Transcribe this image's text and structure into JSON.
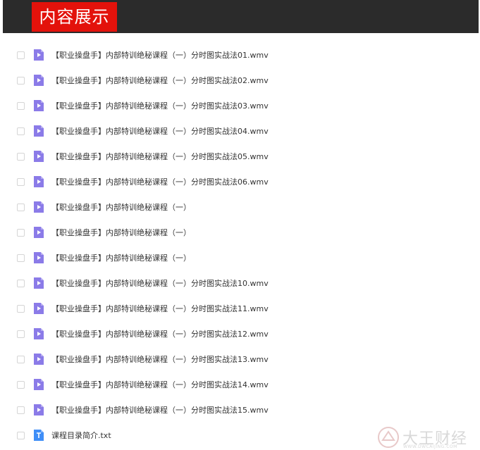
{
  "header": {
    "title": "内容展示"
  },
  "files": [
    {
      "name": "【职业操盘手】内部特训绝秘课程（一）分时图实战法01.wmv",
      "type": "video"
    },
    {
      "name": "【职业操盘手】内部特训绝秘课程（一）分时图实战法02.wmv",
      "type": "video"
    },
    {
      "name": "【职业操盘手】内部特训绝秘课程（一）分时图实战法03.wmv",
      "type": "video"
    },
    {
      "name": "【职业操盘手】内部特训绝秘课程（一）分时图实战法04.wmv",
      "type": "video"
    },
    {
      "name": "【职业操盘手】内部特训绝秘课程（一）分时图实战法05.wmv",
      "type": "video"
    },
    {
      "name": "【职业操盘手】内部特训绝秘课程（一）分时图实战法06.wmv",
      "type": "video"
    },
    {
      "name": "【职业操盘手】内部特训绝秘课程（一）",
      "type": "video"
    },
    {
      "name": "【职业操盘手】内部特训绝秘课程（一）",
      "type": "video"
    },
    {
      "name": "【职业操盘手】内部特训绝秘课程（一）",
      "type": "video"
    },
    {
      "name": "【职业操盘手】内部特训绝秘课程（一）分时图实战法10.wmv",
      "type": "video"
    },
    {
      "name": "【职业操盘手】内部特训绝秘课程（一）分时图实战法11.wmv",
      "type": "video"
    },
    {
      "name": "【职业操盘手】内部特训绝秘课程（一）分时图实战法12.wmv",
      "type": "video"
    },
    {
      "name": "【职业操盘手】内部特训绝秘课程（一）分时图实战法13.wmv",
      "type": "video"
    },
    {
      "name": "【职业操盘手】内部特训绝秘课程（一）分时图实战法14.wmv",
      "type": "video"
    },
    {
      "name": "【职业操盘手】内部特训绝秘课程（一）分时图实战法15.wmv",
      "type": "video"
    },
    {
      "name": "课程目录简介.txt",
      "type": "text"
    }
  ],
  "watermark": {
    "text": "大王财经",
    "sub": "WWW.DWCAIJING.COM"
  },
  "colors": {
    "header_bg": "#2b2b2b",
    "title_bg": "#e3120b",
    "video_icon": "#8b7be8",
    "text_icon": "#3f8ef7"
  }
}
